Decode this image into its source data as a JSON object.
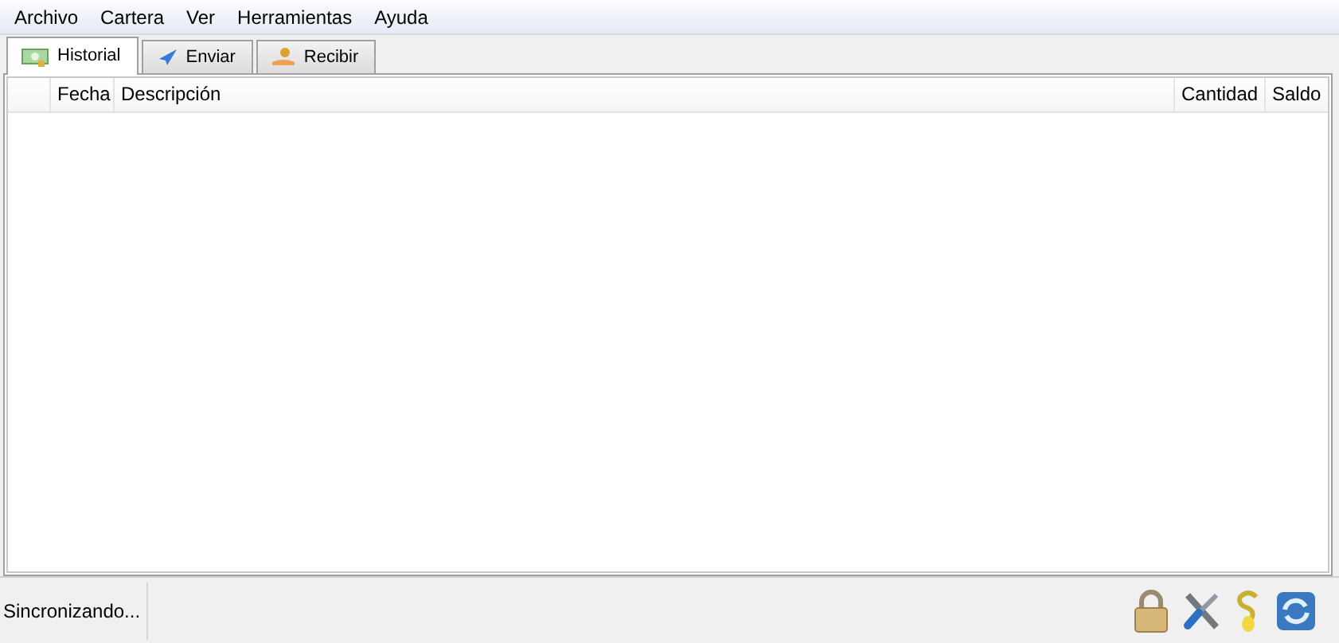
{
  "menu": [
    "Archivo",
    "Cartera",
    "Ver",
    "Herramientas",
    "Ayuda"
  ],
  "tabs": [
    {
      "label": "Historial",
      "selected": true
    },
    {
      "label": "Enviar",
      "selected": false
    },
    {
      "label": "Recibir",
      "selected": false
    }
  ],
  "table": {
    "columns": [
      "Fecha",
      "Descripción",
      "Cantidad",
      "Saldo"
    ]
  },
  "status_bar": {
    "text": "Sincronizando..."
  }
}
